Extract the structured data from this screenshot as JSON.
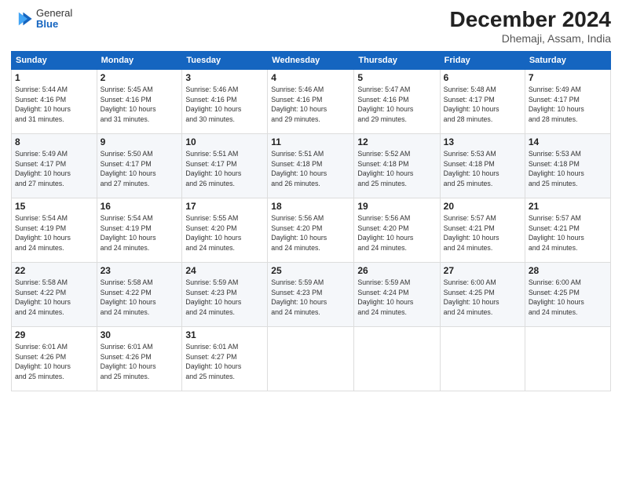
{
  "logo": {
    "general": "General",
    "blue": "Blue"
  },
  "header": {
    "month_year": "December 2024",
    "location": "Dhemaji, Assam, India"
  },
  "days_of_week": [
    "Sunday",
    "Monday",
    "Tuesday",
    "Wednesday",
    "Thursday",
    "Friday",
    "Saturday"
  ],
  "weeks": [
    [
      {
        "day": "1",
        "sunrise": "5:44 AM",
        "sunset": "4:16 PM",
        "daylight": "10 hours and 31 minutes."
      },
      {
        "day": "2",
        "sunrise": "5:45 AM",
        "sunset": "4:16 PM",
        "daylight": "10 hours and 31 minutes."
      },
      {
        "day": "3",
        "sunrise": "5:46 AM",
        "sunset": "4:16 PM",
        "daylight": "10 hours and 30 minutes."
      },
      {
        "day": "4",
        "sunrise": "5:46 AM",
        "sunset": "4:16 PM",
        "daylight": "10 hours and 29 minutes."
      },
      {
        "day": "5",
        "sunrise": "5:47 AM",
        "sunset": "4:16 PM",
        "daylight": "10 hours and 29 minutes."
      },
      {
        "day": "6",
        "sunrise": "5:48 AM",
        "sunset": "4:17 PM",
        "daylight": "10 hours and 28 minutes."
      },
      {
        "day": "7",
        "sunrise": "5:49 AM",
        "sunset": "4:17 PM",
        "daylight": "10 hours and 28 minutes."
      }
    ],
    [
      {
        "day": "8",
        "sunrise": "5:49 AM",
        "sunset": "4:17 PM",
        "daylight": "10 hours and 27 minutes."
      },
      {
        "day": "9",
        "sunrise": "5:50 AM",
        "sunset": "4:17 PM",
        "daylight": "10 hours and 27 minutes."
      },
      {
        "day": "10",
        "sunrise": "5:51 AM",
        "sunset": "4:17 PM",
        "daylight": "10 hours and 26 minutes."
      },
      {
        "day": "11",
        "sunrise": "5:51 AM",
        "sunset": "4:18 PM",
        "daylight": "10 hours and 26 minutes."
      },
      {
        "day": "12",
        "sunrise": "5:52 AM",
        "sunset": "4:18 PM",
        "daylight": "10 hours and 25 minutes."
      },
      {
        "day": "13",
        "sunrise": "5:53 AM",
        "sunset": "4:18 PM",
        "daylight": "10 hours and 25 minutes."
      },
      {
        "day": "14",
        "sunrise": "5:53 AM",
        "sunset": "4:18 PM",
        "daylight": "10 hours and 25 minutes."
      }
    ],
    [
      {
        "day": "15",
        "sunrise": "5:54 AM",
        "sunset": "4:19 PM",
        "daylight": "10 hours and 24 minutes."
      },
      {
        "day": "16",
        "sunrise": "5:54 AM",
        "sunset": "4:19 PM",
        "daylight": "10 hours and 24 minutes."
      },
      {
        "day": "17",
        "sunrise": "5:55 AM",
        "sunset": "4:20 PM",
        "daylight": "10 hours and 24 minutes."
      },
      {
        "day": "18",
        "sunrise": "5:56 AM",
        "sunset": "4:20 PM",
        "daylight": "10 hours and 24 minutes."
      },
      {
        "day": "19",
        "sunrise": "5:56 AM",
        "sunset": "4:20 PM",
        "daylight": "10 hours and 24 minutes."
      },
      {
        "day": "20",
        "sunrise": "5:57 AM",
        "sunset": "4:21 PM",
        "daylight": "10 hours and 24 minutes."
      },
      {
        "day": "21",
        "sunrise": "5:57 AM",
        "sunset": "4:21 PM",
        "daylight": "10 hours and 24 minutes."
      }
    ],
    [
      {
        "day": "22",
        "sunrise": "5:58 AM",
        "sunset": "4:22 PM",
        "daylight": "10 hours and 24 minutes."
      },
      {
        "day": "23",
        "sunrise": "5:58 AM",
        "sunset": "4:22 PM",
        "daylight": "10 hours and 24 minutes."
      },
      {
        "day": "24",
        "sunrise": "5:59 AM",
        "sunset": "4:23 PM",
        "daylight": "10 hours and 24 minutes."
      },
      {
        "day": "25",
        "sunrise": "5:59 AM",
        "sunset": "4:23 PM",
        "daylight": "10 hours and 24 minutes."
      },
      {
        "day": "26",
        "sunrise": "5:59 AM",
        "sunset": "4:24 PM",
        "daylight": "10 hours and 24 minutes."
      },
      {
        "day": "27",
        "sunrise": "6:00 AM",
        "sunset": "4:25 PM",
        "daylight": "10 hours and 24 minutes."
      },
      {
        "day": "28",
        "sunrise": "6:00 AM",
        "sunset": "4:25 PM",
        "daylight": "10 hours and 24 minutes."
      }
    ],
    [
      {
        "day": "29",
        "sunrise": "6:01 AM",
        "sunset": "4:26 PM",
        "daylight": "10 hours and 25 minutes."
      },
      {
        "day": "30",
        "sunrise": "6:01 AM",
        "sunset": "4:26 PM",
        "daylight": "10 hours and 25 minutes."
      },
      {
        "day": "31",
        "sunrise": "6:01 AM",
        "sunset": "4:27 PM",
        "daylight": "10 hours and 25 minutes."
      },
      null,
      null,
      null,
      null
    ]
  ],
  "labels": {
    "sunrise": "Sunrise:",
    "sunset": "Sunset:",
    "daylight": "Daylight:"
  }
}
